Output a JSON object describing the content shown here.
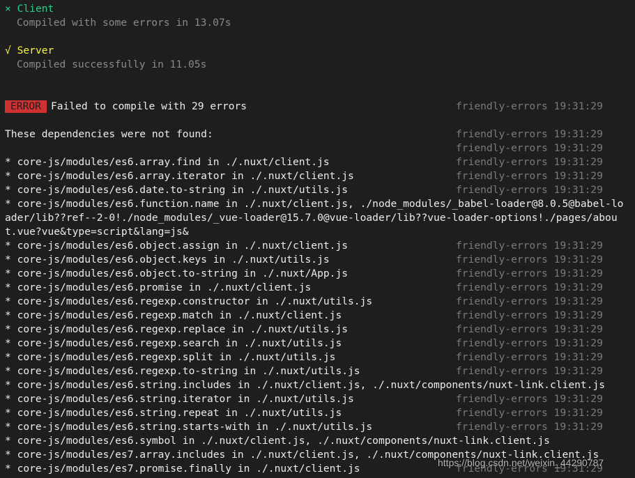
{
  "client": {
    "mark": "×",
    "title": "Client",
    "detail": "Compiled with some errors in 13.07s"
  },
  "server": {
    "mark": "√",
    "title": "Server",
    "detail": "Compiled successfully in 11.05s"
  },
  "error": {
    "badge": "ERROR",
    "message": "Failed to compile with 29 errors",
    "timestamp": "friendly-errors 19:31:29"
  },
  "deps_header": {
    "text": "These dependencies were not found:",
    "timestamp": "friendly-errors 19:31:29"
  },
  "blank_timestamp": "friendly-errors 19:31:29",
  "lines": [
    {
      "text": "* core-js/modules/es6.array.find in ./.nuxt/client.js",
      "timestamp": "friendly-errors 19:31:29"
    },
    {
      "text": "* core-js/modules/es6.array.iterator in ./.nuxt/client.js",
      "timestamp": "friendly-errors 19:31:29"
    },
    {
      "text": "* core-js/modules/es6.date.to-string in ./.nuxt/utils.js",
      "timestamp": "friendly-errors 19:31:29"
    },
    {
      "text": "* core-js/modules/es6.function.name in ./.nuxt/client.js, ./node_modules/_babel-loader@8.0.5@babel-loader/lib??ref--2-0!./node_modules/_vue-loader@15.7.0@vue-loader/lib??vue-loader-options!./pages/about.vue?vue&type=script&lang=js&",
      "timestamp": ""
    },
    {
      "text": "* core-js/modules/es6.object.assign in ./.nuxt/client.js",
      "timestamp": "friendly-errors 19:31:29"
    },
    {
      "text": "* core-js/modules/es6.object.keys in ./.nuxt/utils.js",
      "timestamp": "friendly-errors 19:31:29"
    },
    {
      "text": "* core-js/modules/es6.object.to-string in ./.nuxt/App.js",
      "timestamp": "friendly-errors 19:31:29"
    },
    {
      "text": "* core-js/modules/es6.promise in ./.nuxt/client.js",
      "timestamp": "friendly-errors 19:31:29"
    },
    {
      "text": "* core-js/modules/es6.regexp.constructor in ./.nuxt/utils.js",
      "timestamp": "friendly-errors 19:31:29"
    },
    {
      "text": "* core-js/modules/es6.regexp.match in ./.nuxt/client.js",
      "timestamp": "friendly-errors 19:31:29"
    },
    {
      "text": "* core-js/modules/es6.regexp.replace in ./.nuxt/utils.js",
      "timestamp": "friendly-errors 19:31:29"
    },
    {
      "text": "* core-js/modules/es6.regexp.search in ./.nuxt/utils.js",
      "timestamp": "friendly-errors 19:31:29"
    },
    {
      "text": "* core-js/modules/es6.regexp.split in ./.nuxt/utils.js",
      "timestamp": "friendly-errors 19:31:29"
    },
    {
      "text": "* core-js/modules/es6.regexp.to-string in ./.nuxt/utils.js",
      "timestamp": "friendly-errors 19:31:29"
    },
    {
      "text": "* core-js/modules/es6.string.includes in ./.nuxt/client.js, ./.nuxt/components/nuxt-link.client.js",
      "timestamp": ""
    },
    {
      "text": "* core-js/modules/es6.string.iterator in ./.nuxt/utils.js",
      "timestamp": "friendly-errors 19:31:29"
    },
    {
      "text": "* core-js/modules/es6.string.repeat in ./.nuxt/utils.js",
      "timestamp": "friendly-errors 19:31:29"
    },
    {
      "text": "* core-js/modules/es6.string.starts-with in ./.nuxt/utils.js",
      "timestamp": "friendly-errors 19:31:29"
    },
    {
      "text": "* core-js/modules/es6.symbol in ./.nuxt/client.js, ./.nuxt/components/nuxt-link.client.js",
      "timestamp": ""
    },
    {
      "text": "* core-js/modules/es7.array.includes in ./.nuxt/client.js, ./.nuxt/components/nuxt-link.client.js",
      "timestamp": ""
    },
    {
      "text": "* core-js/modules/es7.promise.finally in ./.nuxt/client.js",
      "timestamp": "friendly-errors 19:31:29"
    }
  ],
  "watermark": "https://blog.csdn.net/weixin_44290787"
}
